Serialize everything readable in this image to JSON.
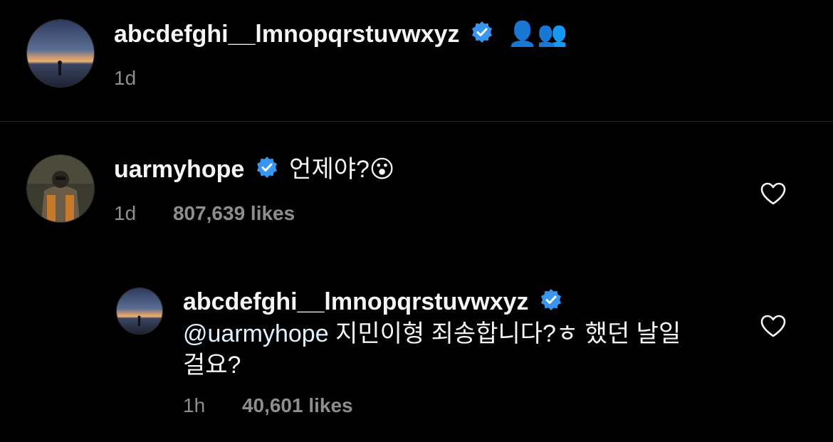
{
  "caption": {
    "username": "abcdefghi__lmnopqrstuvwxyz",
    "emoji": "👤👥",
    "time": "1d"
  },
  "comment": {
    "username": "uarmyhope",
    "text": "언제야?",
    "emoji": "😮",
    "time": "1d",
    "likes": "807,639 likes"
  },
  "reply": {
    "username": "abcdefghi__lmnopqrstuvwxyz",
    "mention": "@uarmyhope",
    "text_line1": " 지민이형 죄송합니다?ㅎ 했던 날일",
    "text_line2": "걸요?",
    "time": "1h",
    "likes": "40,601 likes"
  },
  "colors": {
    "background": "#000000",
    "text": "#f5f5f5",
    "muted": "#8e8e8e",
    "verified": "#3797f0",
    "mention": "#e0f1ff"
  }
}
